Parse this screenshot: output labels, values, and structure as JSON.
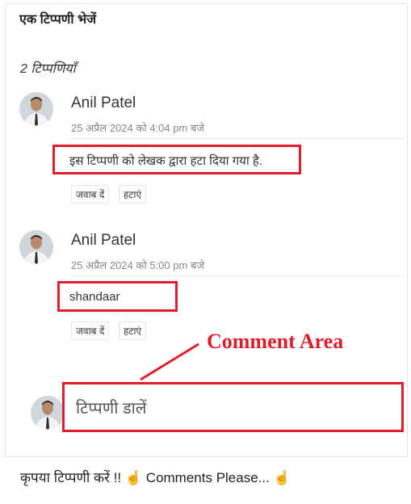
{
  "section_title": "एक टिप्पणी भेजें",
  "comment_count": "2 टिप्पणियाँ",
  "comments": [
    {
      "author": "Anil Patel",
      "date": "25 अप्रैल 2024 को 4:04 pm बजे",
      "text": "इस टिप्पणी को लेखक द्वारा हटा दिया गया है.",
      "reply_label": "जवाब दें",
      "delete_label": "हटाएं"
    },
    {
      "author": "Anil Patel",
      "date": "25 अप्रैल 2024 को 5:00 pm बजे",
      "text": "shandaar",
      "reply_label": "जवाब दें",
      "delete_label": "हटाएं"
    }
  ],
  "annotation": "Comment Area",
  "comment_input": {
    "placeholder": "टिप्पणी डालें"
  },
  "footer": {
    "text": "कृपया टिप्पणी करें !! ",
    "hand1": "☝",
    "text2": " Comments Please... ",
    "hand2": "☝"
  },
  "colors": {
    "highlight": "#e01e2b",
    "border": "#e3e3e3"
  }
}
